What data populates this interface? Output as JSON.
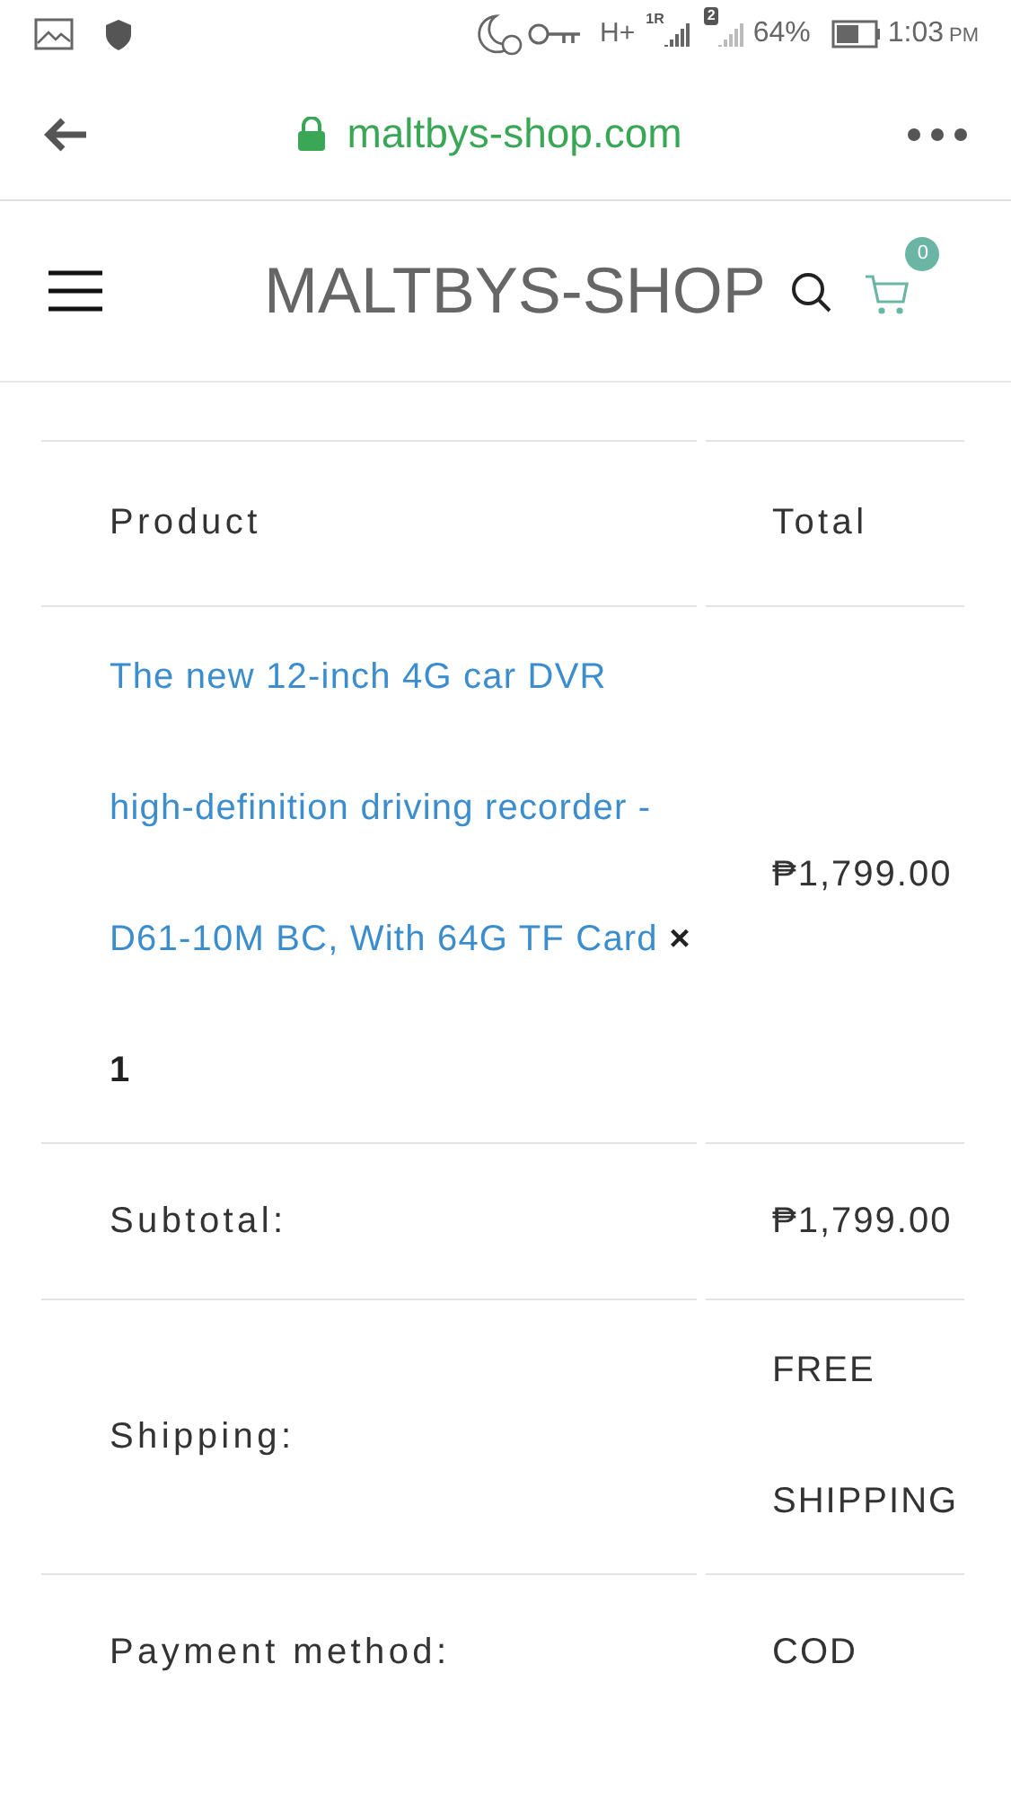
{
  "status_bar": {
    "network": "H+",
    "roaming": "1R",
    "sim_badge": "2",
    "battery": "64%",
    "time": "1:03",
    "ampm": "PM"
  },
  "browser": {
    "url": "maltbys-shop.com"
  },
  "header": {
    "logo": "MALTBYS-SHOP",
    "cart_count": "0"
  },
  "order_table": {
    "columns": [
      "Product",
      "Total"
    ],
    "product": {
      "name": "The new 12-inch 4G car DVR high-definition driving recorder - D61-10M BC, With 64G TF Card",
      "quantity": "× 1",
      "total": "₱1,799.00"
    },
    "rows": [
      {
        "label": "Subtotal:",
        "value": "₱1,799.00"
      },
      {
        "label": "Shipping:",
        "value": "FREE SHIPPING"
      },
      {
        "label": "Payment method:",
        "value": "COD"
      }
    ]
  }
}
